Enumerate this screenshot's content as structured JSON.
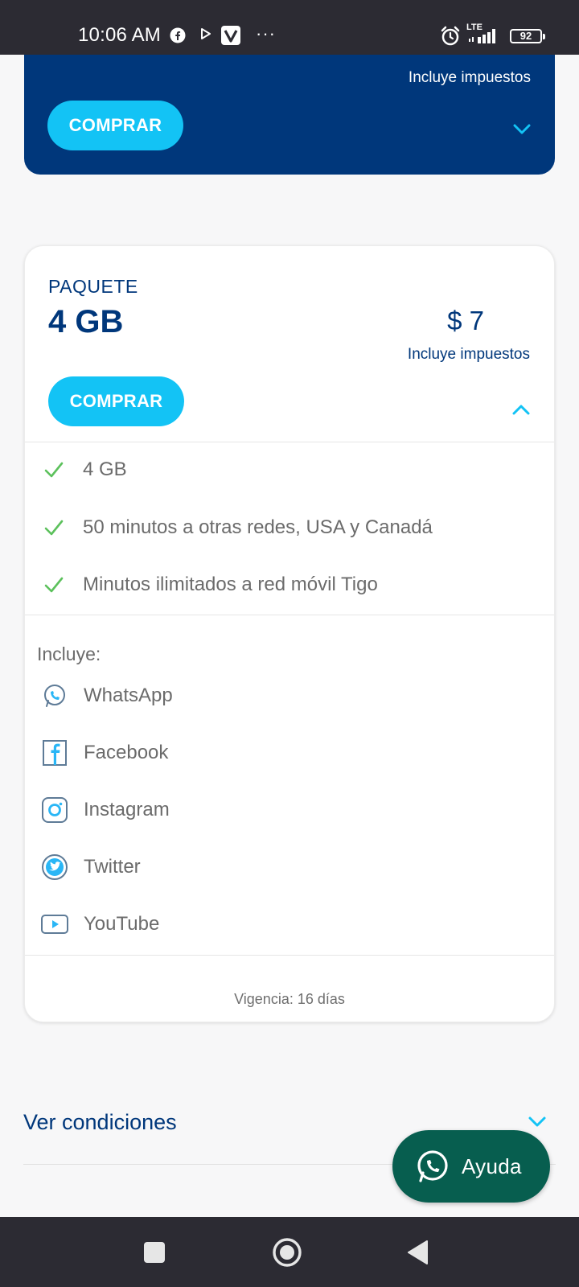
{
  "status_bar": {
    "time": "10:06 AM",
    "network": "LTE",
    "battery": "92",
    "more": "···",
    "icons": [
      "facebook-icon",
      "play-icon",
      "v-app-icon",
      "alarm-icon",
      "signal-icon",
      "battery-icon"
    ]
  },
  "top_card": {
    "tax_note": "Incluye impuestos",
    "buy_label": "COMPRAR",
    "expand_icon": "chevron-down-icon"
  },
  "package": {
    "label": "PAQUETE",
    "size": "4 GB",
    "price": "$ 7",
    "tax_note": "Incluye impuestos",
    "buy_label": "COMPRAR",
    "collapse_icon": "chevron-up-icon",
    "features": [
      "4 GB",
      "50 minutos a otras redes, USA y Canadá",
      "Minutos ilimitados a red móvil Tigo"
    ],
    "includes_title": "Incluye:",
    "apps": [
      {
        "name": "WhatsApp",
        "icon": "whatsapp-icon"
      },
      {
        "name": "Facebook",
        "icon": "facebook-icon"
      },
      {
        "name": "Instagram",
        "icon": "instagram-icon"
      },
      {
        "name": "Twitter",
        "icon": "twitter-icon"
      },
      {
        "name": "YouTube",
        "icon": "youtube-icon"
      }
    ],
    "validity": "Vigencia: 16 días"
  },
  "conditions": {
    "label": "Ver condiciones"
  },
  "help_button": {
    "label": "Ayuda"
  },
  "colors": {
    "brand_navy": "#00377b",
    "buy_button": "#13c3f5",
    "check_green": "#5cc15c",
    "help_green": "#075e4f",
    "system_bar": "#2c2b33"
  }
}
